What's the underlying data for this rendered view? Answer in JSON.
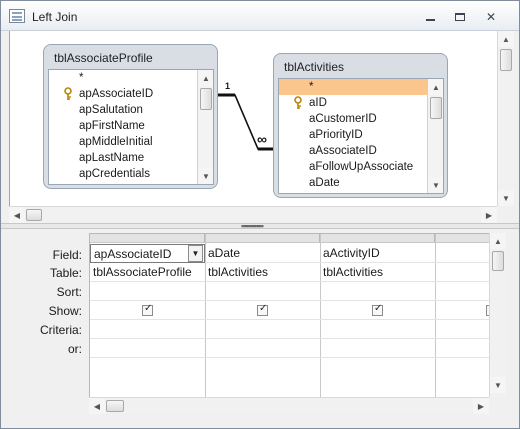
{
  "window": {
    "title": "Left Join"
  },
  "tables": [
    {
      "name": "tblAssociateProfile",
      "fields": [
        "*",
        "apAssociateID",
        "apSalutation",
        "apFirstName",
        "apMiddleInitial",
        "apLastName",
        "apCredentials"
      ],
      "key_field": "apAssociateID"
    },
    {
      "name": "tblActivities",
      "fields": [
        "*",
        "aID",
        "aCustomerID",
        "aPriorityID",
        "aAssociateID",
        "aFollowUpAssociate",
        "aDate"
      ],
      "key_field": "aID",
      "selected_field": "*"
    }
  ],
  "join": {
    "left_symbol": "1",
    "right_symbol": "∞"
  },
  "grid": {
    "row_labels": [
      "Field:",
      "Table:",
      "Sort:",
      "Show:",
      "Criteria:",
      "or:"
    ],
    "columns": [
      {
        "field": "apAssociateID",
        "table": "tblAssociateProfile",
        "show": true
      },
      {
        "field": "aDate",
        "table": "tblActivities",
        "show": true
      },
      {
        "field": "aActivityID",
        "table": "tblActivities",
        "show": true
      }
    ]
  },
  "icons": [
    "app-icon",
    "minimize-icon",
    "maximize-icon",
    "close-icon",
    "key-icon",
    "dropdown-arrow-icon",
    "checkbox-icon"
  ]
}
